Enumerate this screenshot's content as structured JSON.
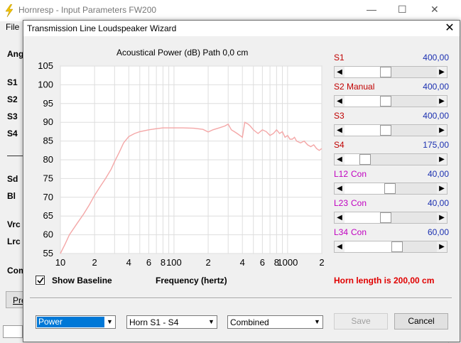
{
  "background_window": {
    "title": "Hornresp - Input Parameters   FW200",
    "menu_file": "File",
    "labels": [
      "Ang",
      "S1",
      "S2",
      "S3",
      "S4",
      "Sd",
      "Bl",
      "Vrc",
      "Lrc",
      "Com"
    ],
    "button_fragment": "Pre",
    "controls": {
      "minimize": "—",
      "maximize": "☐",
      "close": "✕"
    }
  },
  "dialog": {
    "title": "Transmission Line Loudspeaker Wizard",
    "close_glyph": "✕"
  },
  "chart_header": {
    "title": "Acoustical Power (dB)   Path 0,0 cm",
    "xlabel": "Frequency (hertz)"
  },
  "chart_data": {
    "type": "line",
    "ylim": [
      55,
      105
    ],
    "xlim": [
      10,
      2000
    ],
    "x_scale": "log",
    "y_ticks": [
      105,
      100,
      95,
      90,
      85,
      80,
      75,
      70,
      65,
      60,
      55
    ],
    "x_tick_labels": [
      {
        "v": 10,
        "t": "10"
      },
      {
        "v": 20,
        "t": "2"
      },
      {
        "v": 40,
        "t": "4"
      },
      {
        "v": 60,
        "t": "6"
      },
      {
        "v": 80,
        "t": "8"
      },
      {
        "v": 100,
        "t": "100"
      },
      {
        "v": 200,
        "t": "2"
      },
      {
        "v": 400,
        "t": "4"
      },
      {
        "v": 600,
        "t": "6"
      },
      {
        "v": 800,
        "t": "8"
      },
      {
        "v": 1000,
        "t": "1000"
      },
      {
        "v": 2000,
        "t": "2"
      }
    ],
    "grid": true,
    "series_color": "#f4a7a7",
    "series": [
      {
        "x": [
          10,
          11,
          12,
          14,
          16,
          18,
          20,
          22,
          25,
          28,
          30,
          33,
          36,
          40,
          45,
          50,
          60,
          70,
          80,
          100,
          120,
          150,
          180,
          200,
          220,
          250,
          280,
          300,
          320,
          340,
          360,
          380,
          400,
          420,
          450,
          470,
          500,
          550,
          600,
          650,
          700,
          750,
          800,
          850,
          900,
          950,
          1000,
          1050,
          1100,
          1150,
          1200,
          1300,
          1400,
          1500,
          1600,
          1700,
          1800,
          1900,
          2000
        ],
        "y": [
          55,
          57.5,
          60,
          63,
          65.5,
          68,
          70.5,
          72.5,
          75,
          77.5,
          79.5,
          82,
          84.5,
          86.2,
          87,
          87.5,
          88,
          88.3,
          88.5,
          88.5,
          88.5,
          88.4,
          88.1,
          87.4,
          88,
          88.5,
          89,
          89.5,
          88,
          87.5,
          87,
          86.5,
          86,
          90,
          89.5,
          89,
          88,
          87,
          88,
          87.5,
          86.5,
          87,
          88,
          87,
          87.5,
          86,
          86.5,
          85.5,
          85.5,
          86,
          85,
          84.5,
          85,
          84,
          83.5,
          84,
          83,
          82.5,
          83
        ]
      }
    ]
  },
  "show_baseline": {
    "label": "Show Baseline",
    "checked": true
  },
  "sliders": [
    {
      "name": "S1",
      "mode": "",
      "value": "400,00",
      "color": "red",
      "thumb": 0.44
    },
    {
      "name": "S2",
      "mode": "Manual",
      "value": "400,00",
      "color": "red",
      "thumb": 0.44
    },
    {
      "name": "S3",
      "mode": "",
      "value": "400,00",
      "color": "red",
      "thumb": 0.44
    },
    {
      "name": "S4",
      "mode": "",
      "value": "175,00",
      "color": "red",
      "thumb": 0.18
    },
    {
      "name": "L12",
      "mode": "Con",
      "value": "40,00",
      "color": "magenta",
      "thumb": 0.49
    },
    {
      "name": "L23",
      "mode": "Con",
      "value": "40,00",
      "color": "magenta",
      "thumb": 0.44
    },
    {
      "name": "L34",
      "mode": "Con",
      "value": "60,00",
      "color": "magenta",
      "thumb": 0.58
    }
  ],
  "horn_length": "Horn length is 200,00 cm",
  "bottom": {
    "combo_power": "Power",
    "combo_horn": "Horn S1 - S4",
    "combo_combined": "Combined",
    "save": "Save",
    "cancel": "Cancel"
  },
  "colors": {
    "label_red": "#c00000",
    "value_blue": "#1a2fb0",
    "label_magenta": "#c000c0",
    "horn_length": "#e00000",
    "selected_combo": "#0078d7"
  }
}
